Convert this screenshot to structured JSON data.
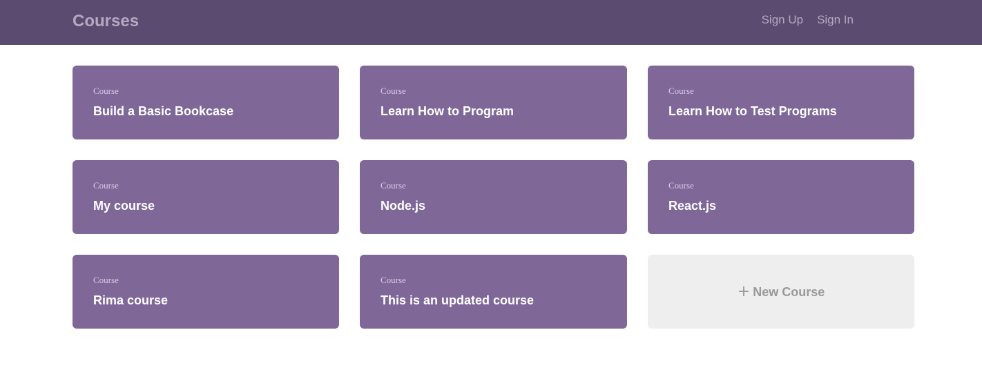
{
  "header": {
    "title": "Courses",
    "nav": {
      "sign_up": "Sign Up",
      "sign_in": "Sign In"
    }
  },
  "courses": [
    {
      "label": "Course",
      "title": "Build a Basic Bookcase"
    },
    {
      "label": "Course",
      "title": "Learn How to Program"
    },
    {
      "label": "Course",
      "title": "Learn How to Test Programs"
    },
    {
      "label": "Course",
      "title": "My course"
    },
    {
      "label": "Course",
      "title": "Node.js"
    },
    {
      "label": "Course",
      "title": "React.js"
    },
    {
      "label": "Course",
      "title": "Rima course"
    },
    {
      "label": "Course",
      "title": "This is an updated course"
    }
  ],
  "new_course": {
    "icon": "plus-icon",
    "label": "New Course"
  },
  "colors": {
    "header_bg": "#5c4b71",
    "card_bg": "#7f6798",
    "new_card_bg": "#eeeeee"
  }
}
